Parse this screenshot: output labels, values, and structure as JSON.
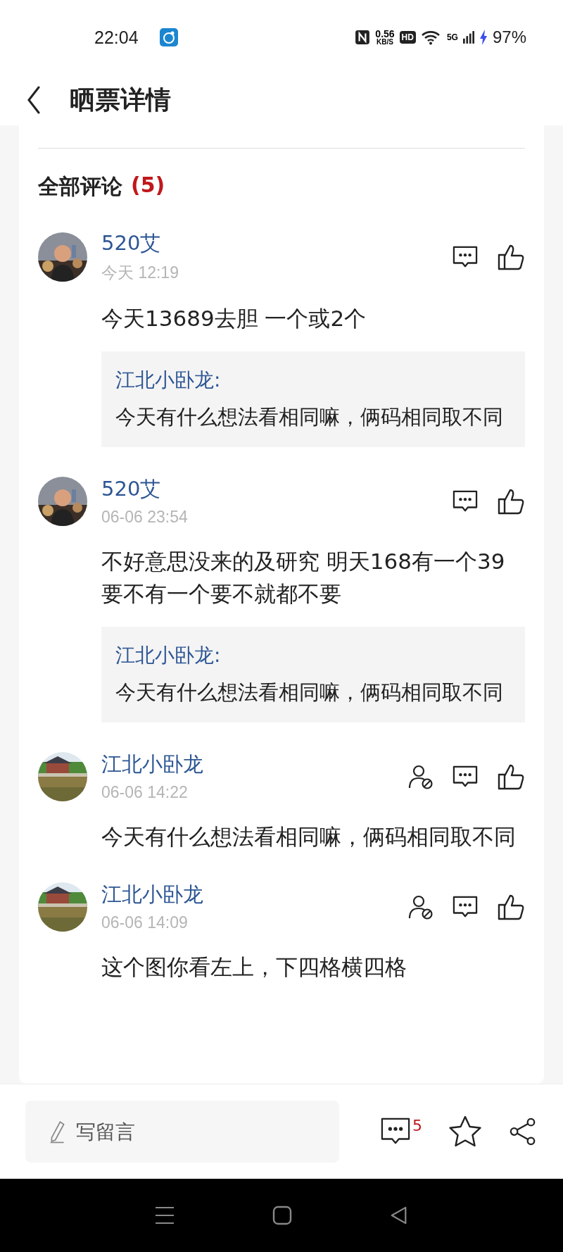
{
  "status_bar": {
    "time": "22:04",
    "net_speed": "0.56",
    "net_unit": "KB/S",
    "hd": "HD",
    "network": "5G",
    "battery": "97%"
  },
  "header": {
    "title": "晒票详情"
  },
  "comments_section": {
    "title": "全部评论",
    "count": "(5)"
  },
  "comments": [
    {
      "author": "520艾",
      "time": "今天 12:19",
      "text": "今天13689去胆 一个或2个",
      "can_block": false,
      "reply": {
        "author": "江北小卧龙:",
        "text": "今天有什么想法看相同嘛，俩码相同取不同"
      }
    },
    {
      "author": "520艾",
      "time": "06-06 23:54",
      "text": "不好意思没来的及研究 明天168有一个39要不有一个要不就都不要",
      "can_block": false,
      "reply": {
        "author": "江北小卧龙:",
        "text": "今天有什么想法看相同嘛，俩码相同取不同"
      }
    },
    {
      "author": "江北小卧龙",
      "time": "06-06 14:22",
      "text": "今天有什么想法看相同嘛，俩码相同取不同",
      "can_block": true
    },
    {
      "author": "江北小卧龙",
      "time": "06-06 14:09",
      "text": "这个图你看左上，下四格横四格",
      "can_block": true
    }
  ],
  "bottom_bar": {
    "placeholder": "写留言",
    "comment_count": "5"
  }
}
